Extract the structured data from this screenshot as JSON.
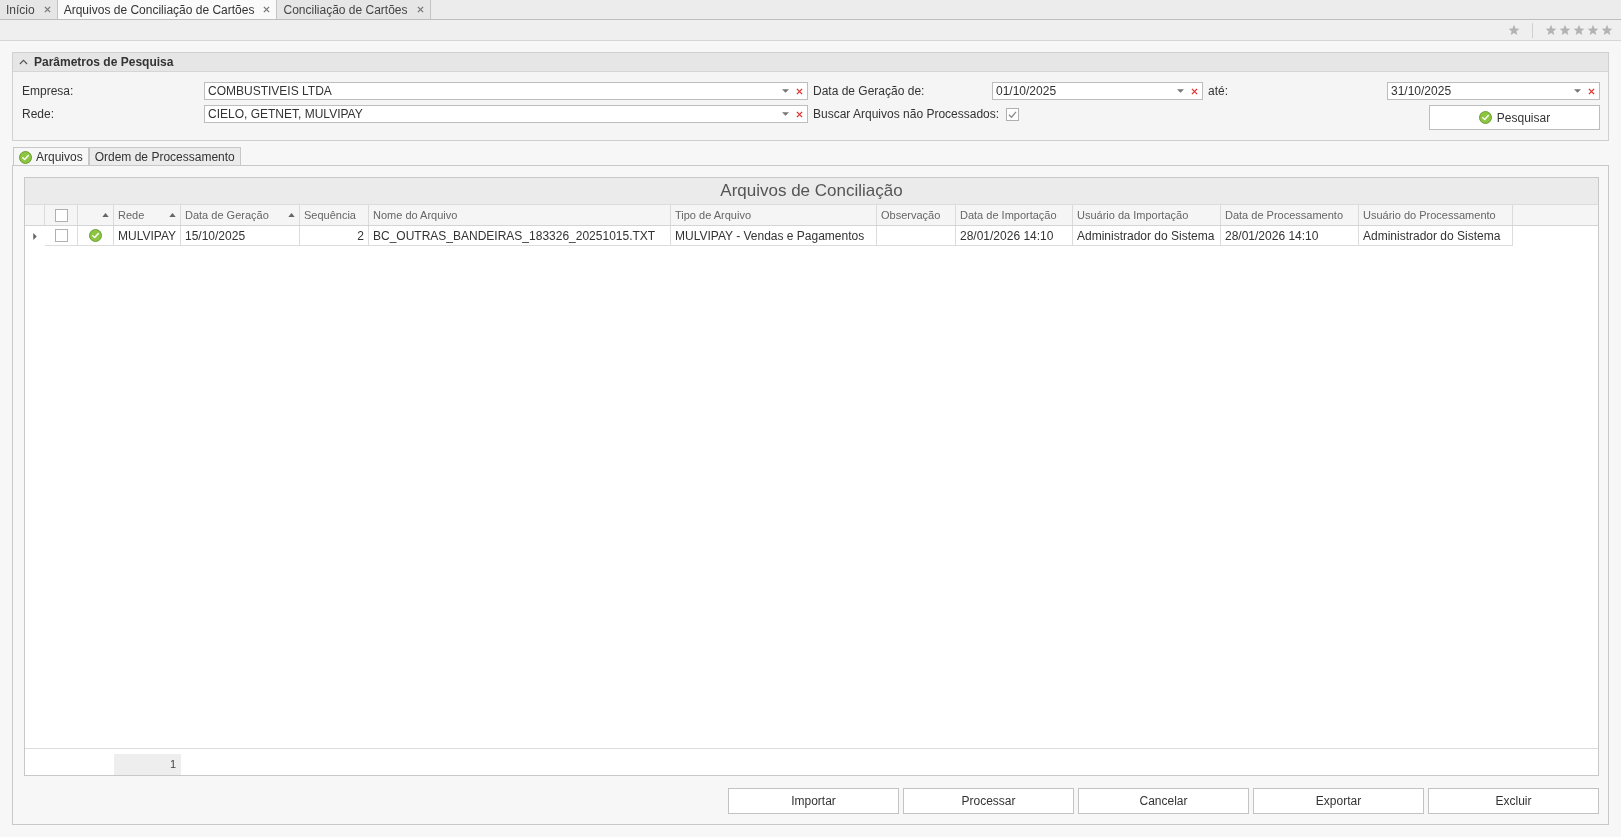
{
  "tabs": [
    {
      "label": "Início",
      "selected": false
    },
    {
      "label": "Arquivos de Conciliação de Cartões",
      "selected": true
    },
    {
      "label": "Conciliação de Cartões",
      "selected": false
    }
  ],
  "toolbar": {
    "favorite": {
      "on": false
    },
    "rating": {
      "stars": 0
    }
  },
  "search_panel": {
    "title": "Parâmetros de Pesquisa",
    "expanded": true,
    "fields": [
      {
        "kind": "combo",
        "label": "Empresa:",
        "value": "COMBUSTIVEIS LTDA"
      },
      {
        "kind": "combo",
        "label": "Data de Geração de:",
        "value": "01/10/2025"
      },
      {
        "kind": "combo",
        "label": "até:",
        "value": "31/10/2025"
      },
      {
        "kind": "combo",
        "label": "Rede:",
        "value": "CIELO, GETNET, MULVIPAY"
      },
      {
        "kind": "checkbox",
        "label": "Buscar Arquivos não Processados:",
        "checked": true
      }
    ],
    "button": {
      "label": "Pesquisar"
    }
  },
  "view_tabs": [
    {
      "label": "Arquivos",
      "selected": true
    },
    {
      "label": "Ordem de Processamento",
      "selected": false
    }
  ],
  "grid": {
    "title": "Arquivos de Conciliação",
    "select_all": {
      "checked": false
    },
    "status_column": {
      "sorted": true
    },
    "columns": [
      {
        "kind": "text",
        "label": "Rede",
        "sorted": true
      },
      {
        "kind": "text",
        "label": "Data de Geração",
        "sorted": true
      },
      {
        "kind": "number",
        "label": "Sequência",
        "sorted": false
      },
      {
        "kind": "text",
        "label": "Nome do Arquivo",
        "sorted": false
      },
      {
        "kind": "text",
        "label": "Tipo de Arquivo",
        "sorted": false
      },
      {
        "kind": "text",
        "label": "Observação",
        "sorted": false
      },
      {
        "kind": "text",
        "label": "Data de Importação",
        "sorted": false
      },
      {
        "kind": "text",
        "label": "Usuário da Importação",
        "sorted": false
      },
      {
        "kind": "text",
        "label": "Data de Processamento",
        "sorted": false
      },
      {
        "kind": "text",
        "label": "Usuário do Processamento",
        "sorted": false
      }
    ],
    "rows": [
      {
        "focused": true,
        "checked": false,
        "processed": true,
        "cells": [
          "MULVIPAY",
          "15/10/2025",
          "2",
          "BC_OUTRAS_BANDEIRAS_183326_20251015.TXT",
          "MULVIPAY - Vendas e Pagamentos",
          "",
          "28/01/2026 14:10",
          "Administrador do Sistema",
          "28/01/2026 14:10",
          "Administrador do Sistema"
        ]
      }
    ],
    "summary": "1"
  },
  "buttons": [
    "Importar",
    "Processar",
    "Cancelar",
    "Exportar",
    "Excluir"
  ]
}
